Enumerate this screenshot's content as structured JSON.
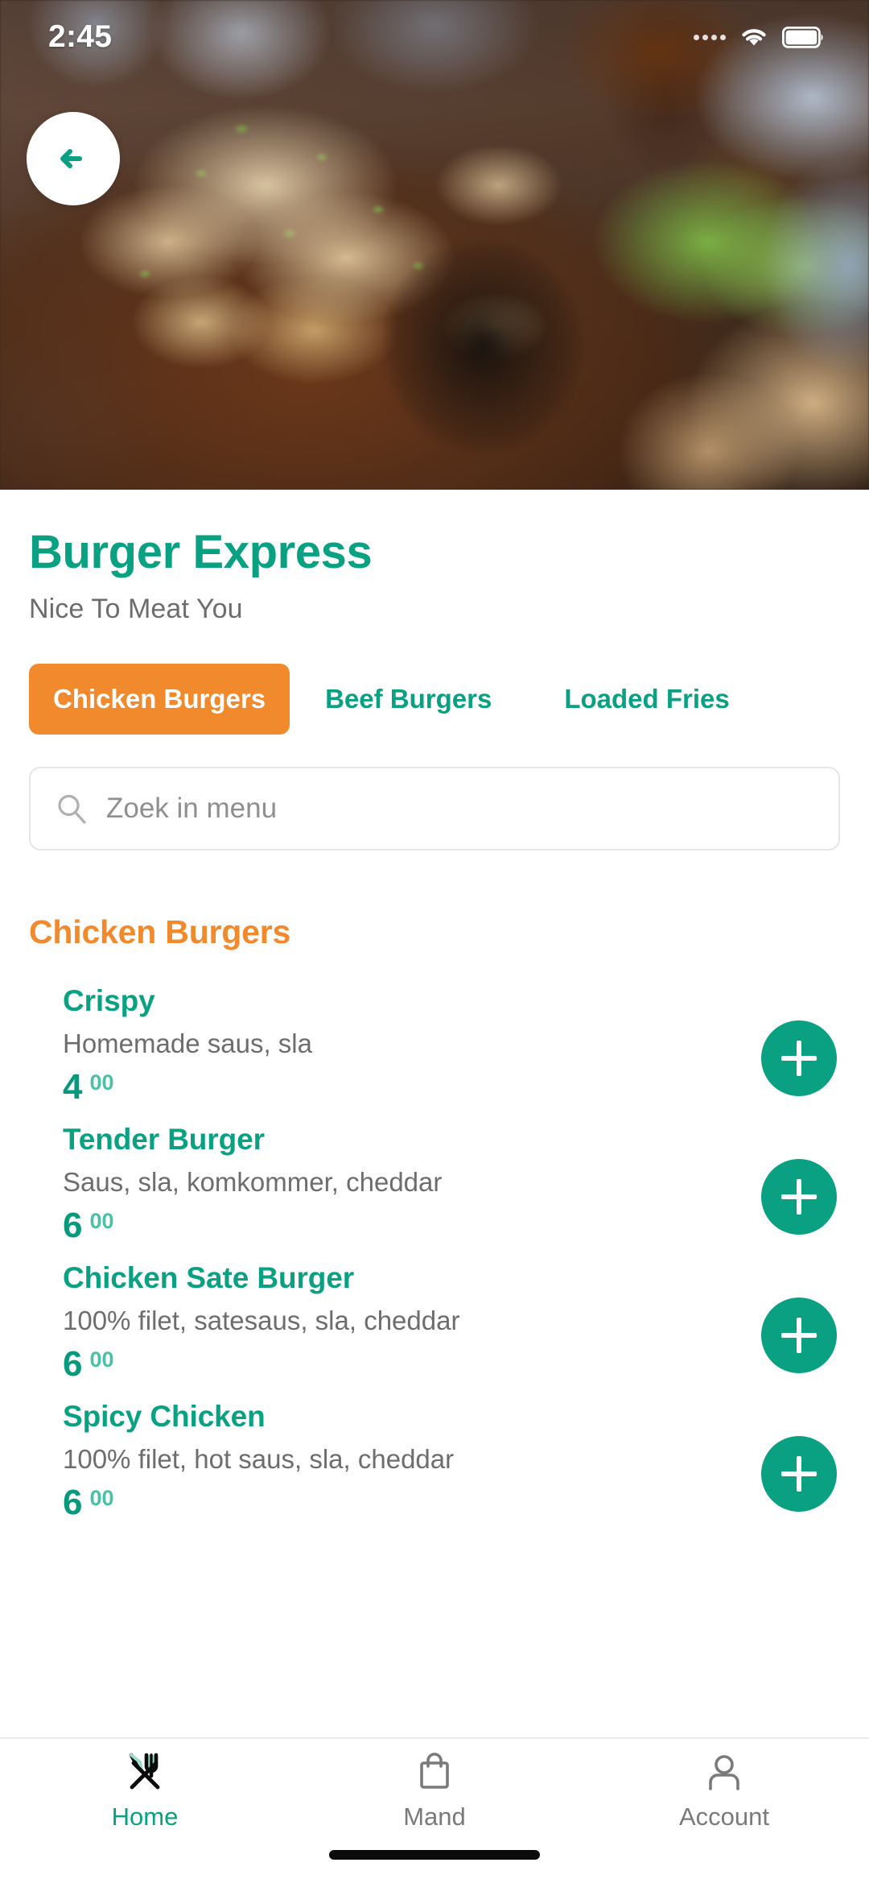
{
  "status_bar": {
    "time": "2:45",
    "signal_icon": "signal-dots-icon",
    "wifi_icon": "wifi-icon",
    "battery_icon": "battery-full-icon"
  },
  "hero": {
    "image_name": "restaurant-food-photo",
    "alt": "Wooden plate with cheesy bread, salad and dip bowl"
  },
  "back_button": {
    "icon": "arrow-left-icon",
    "label": "Back"
  },
  "restaurant": {
    "name": "Burger Express",
    "tagline": "Nice To Meat You"
  },
  "tabs": [
    {
      "label": "Chicken Burgers",
      "active": true
    },
    {
      "label": "Beef Burgers",
      "active": false
    },
    {
      "label": "Loaded Fries",
      "active": false
    }
  ],
  "search": {
    "icon": "search-icon",
    "placeholder": "Zoek in menu",
    "value": ""
  },
  "menu_section": {
    "title": "Chicken Burgers",
    "items": [
      {
        "name": "Crispy",
        "description": "Homemade saus, sla",
        "price_int": "4",
        "price_dec": "00",
        "add_icon": "plus-icon"
      },
      {
        "name": "Tender Burger",
        "description": "Saus, sla, komkommer, cheddar",
        "price_int": "6",
        "price_dec": "00",
        "add_icon": "plus-icon"
      },
      {
        "name": "Chicken Sate Burger",
        "description": "100% filet, satesaus, sla, cheddar",
        "price_int": "6",
        "price_dec": "00",
        "add_icon": "plus-icon"
      },
      {
        "name": "Spicy Chicken",
        "description": "100% filet, hot saus, sla, cheddar",
        "price_int": "6",
        "price_dec": "00",
        "add_icon": "plus-icon"
      }
    ]
  },
  "bottom_nav": [
    {
      "label": "Home",
      "icon": "cutlery-icon",
      "active": true
    },
    {
      "label": "Mand",
      "icon": "shopping-bag-icon",
      "active": false
    },
    {
      "label": "Account",
      "icon": "person-icon",
      "active": false
    }
  ],
  "colors": {
    "teal": "#0AA183",
    "teal_dark": "#07997B",
    "teal_light": "#4BC0A6",
    "orange": "#F08A2C",
    "gray_text": "#6d6d6d",
    "nav_inactive": "#7a7a7a"
  }
}
